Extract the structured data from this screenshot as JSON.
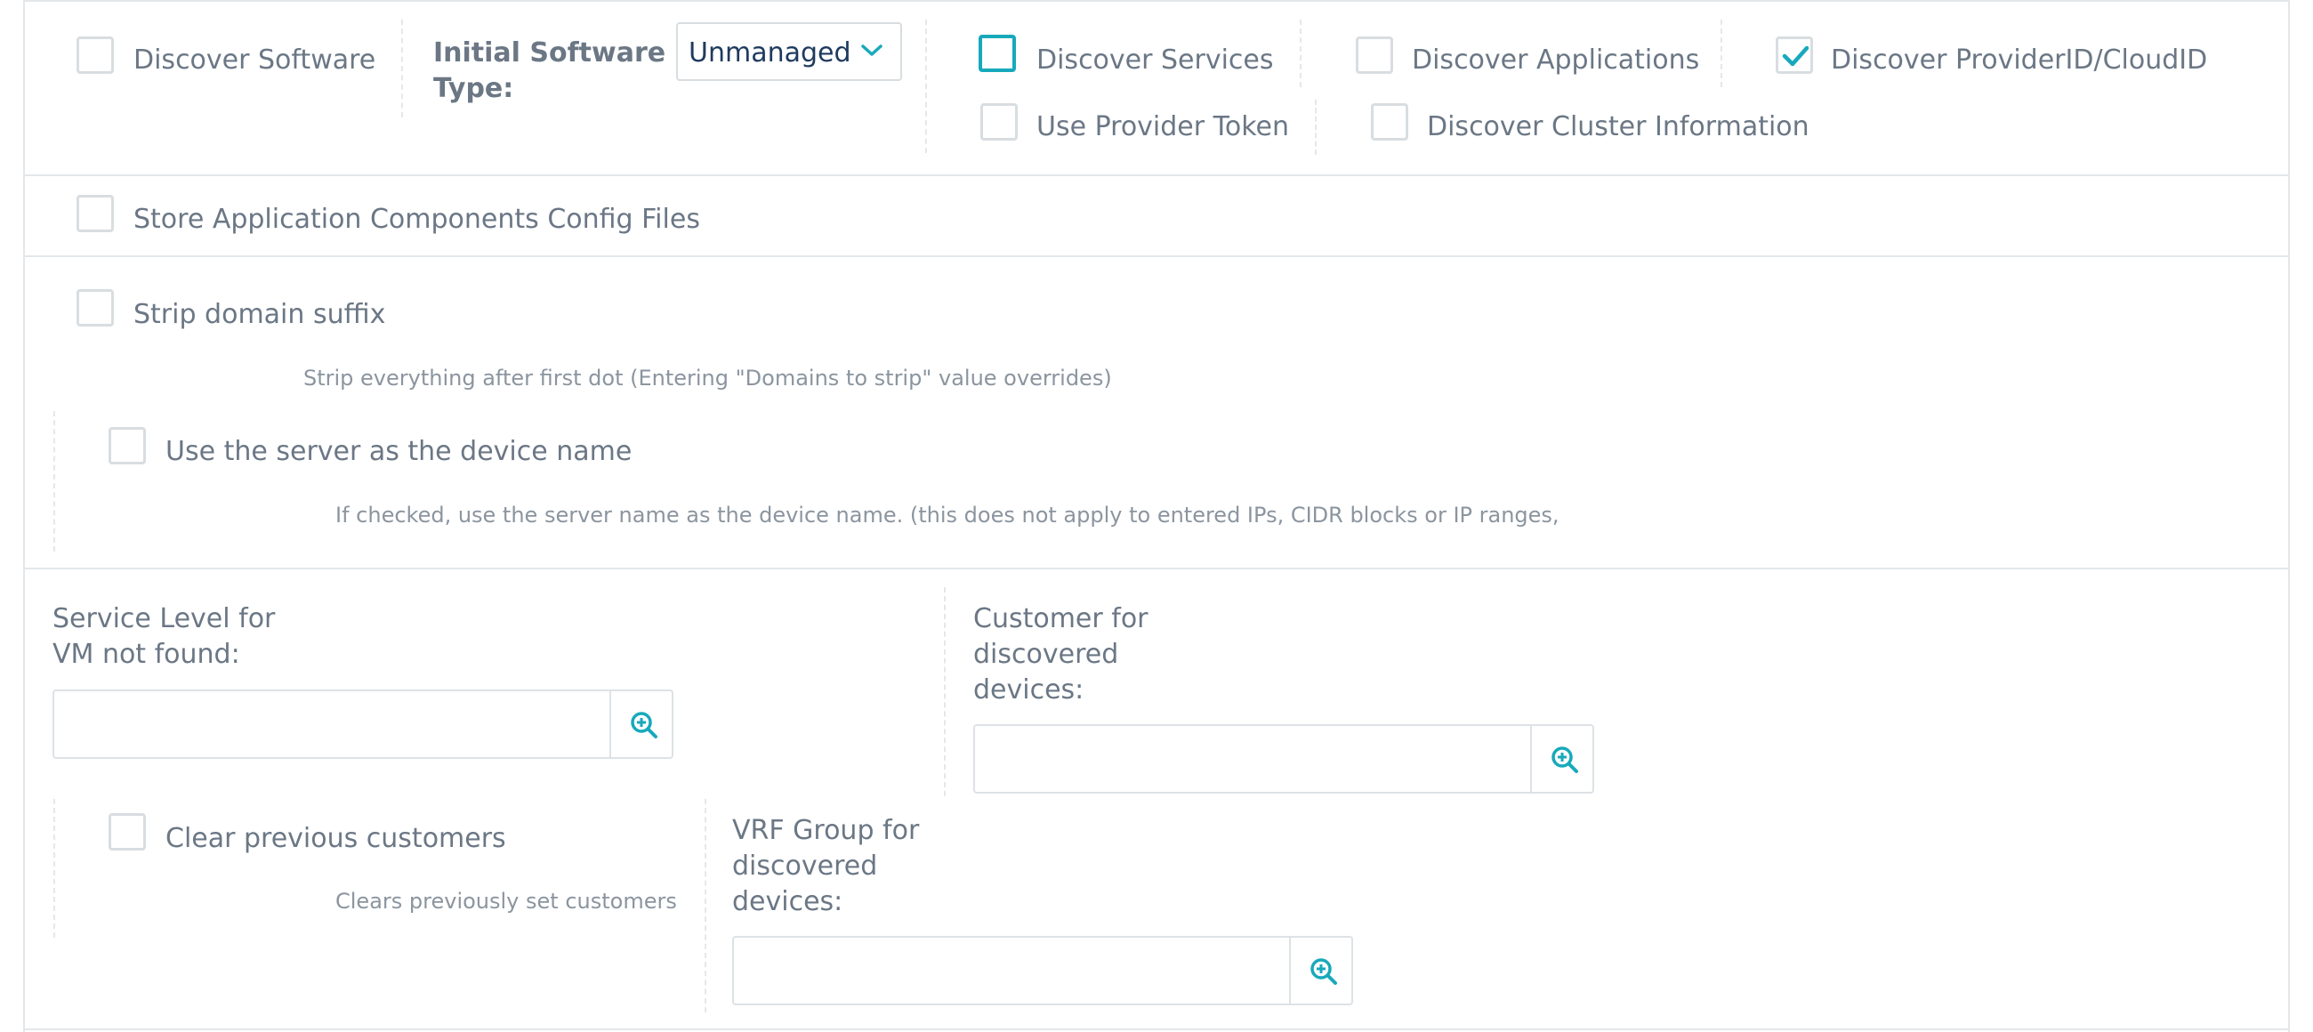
{
  "row1": {
    "discover_software": {
      "label": "Discover Software",
      "checked": false
    },
    "initial_software_type": {
      "label_line1": "Initial Software",
      "label_line2": "Type:",
      "selected": "Unmanaged"
    },
    "discover_services": {
      "label": "Discover Services",
      "checked": false
    },
    "use_provider_token": {
      "label": "Use Provider Token",
      "checked": false
    },
    "discover_applications": {
      "label": "Discover Applications",
      "checked": false
    },
    "discover_cluster_information": {
      "label": "Discover Cluster Information",
      "checked": false
    },
    "discover_provider_cloud_id": {
      "label": "Discover ProviderID/CloudID",
      "checked": true
    }
  },
  "store_config_files": {
    "label": "Store Application Components Config Files",
    "checked": false
  },
  "strip_domain_suffix": {
    "label": "Strip domain suffix",
    "hint": "Strip everything after first dot (Entering \"Domains to strip\" value overrides)",
    "checked": false
  },
  "use_server_as_device_name": {
    "label": "Use the server as the device name",
    "hint": "If checked, use the server name as the device name. (this does not apply to entered IPs, CIDR blocks or IP ranges,",
    "checked": false
  },
  "service_level": {
    "label_line1": "Service Level for",
    "label_line2": "VM not found:",
    "value": ""
  },
  "customer": {
    "label_line1": "Customer for",
    "label_line2": "discovered",
    "label_line3": "devices:",
    "value": ""
  },
  "clear_previous_customers": {
    "label": "Clear previous customers",
    "hint": "Clears previously set customers",
    "checked": false
  },
  "vrf_group": {
    "label_line1": "VRF Group for",
    "label_line2": "discovered",
    "label_line3": "devices:",
    "value": ""
  },
  "colors": {
    "accent": "#17a9bb",
    "text": "#6b7785",
    "select_text": "#1f3a5f",
    "border": "#d8dde1"
  },
  "icons": {
    "chevron": "chevron-down-icon",
    "lookup": "zoom-in-icon",
    "check": "checkmark-icon"
  }
}
